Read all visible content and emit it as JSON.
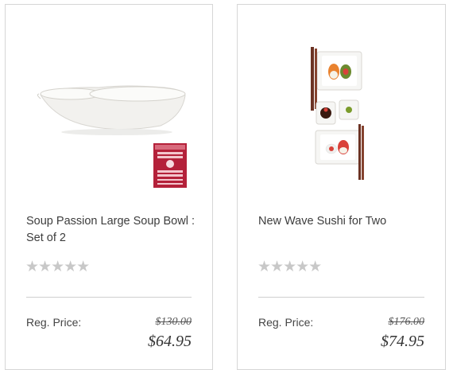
{
  "products": [
    {
      "title": "Soup Passion Large Soup Bowl : Set of 2",
      "rating": 0,
      "stars": "★★★★★",
      "price_label": "Reg. Price:",
      "regular_price": "$130.00",
      "sale_price": "$64.95",
      "image": "white-soup-bowl-with-handle-and-award-badge"
    },
    {
      "title": "New Wave Sushi for Two",
      "rating": 0,
      "stars": "★★★★★",
      "price_label": "Reg. Price:",
      "regular_price": "$176.00",
      "sale_price": "$74.95",
      "image": "sushi-plates-with-chopsticks"
    }
  ],
  "colors": {
    "card_border": "#d6d6d6",
    "star_empty": "#c8c8c8",
    "badge": "#b4213a"
  }
}
